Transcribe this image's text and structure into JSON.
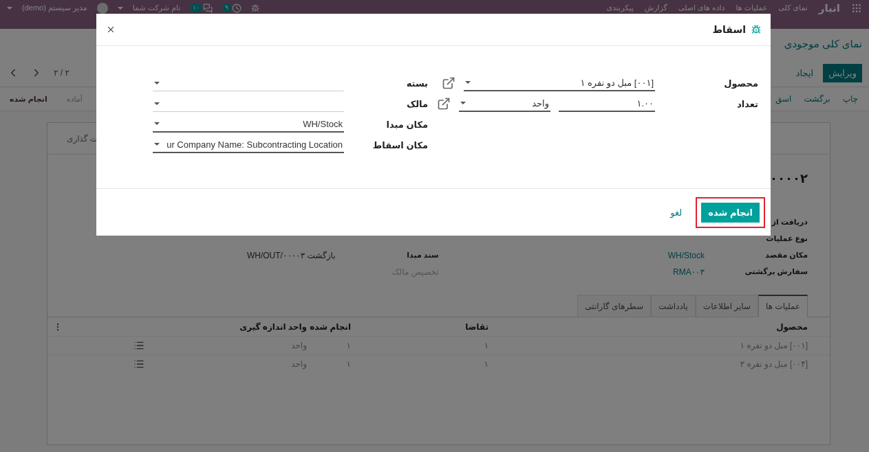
{
  "navbar": {
    "app_name": "انبار",
    "menu": [
      "نمای کلی",
      "عملیات ها",
      "داده های اصلی",
      "گزارش",
      "پیکربندی"
    ],
    "user": "مدیر سیستم (demo)",
    "company": "نام شرکت شما",
    "messages_count": "۱۰",
    "activities_count": "۹"
  },
  "breadcrumb": "نمای کلی موجودی",
  "buttons": [
    {
      "label": "ویرایش",
      "kind": "primary"
    },
    {
      "label": "ایجاد",
      "kind": "secondary"
    }
  ],
  "pager": "۲ / ۲",
  "actions": [
    "چاپ",
    "برگشت",
    "اسق"
  ],
  "stages": [
    {
      "label": "آماده",
      "selected": false
    },
    {
      "label": "انجام شده",
      "selected": true
    }
  ],
  "smart_button": "ت گذاری",
  "record_title": "۰۰۰۰۲",
  "fields_right": [
    {
      "label": "دریافت از"
    },
    {
      "label": "نوع عملیات"
    },
    {
      "label": "مکان مقصد",
      "value": "WH/Stock",
      "kind": "link"
    },
    {
      "label": "سفارش برگشتی",
      "value": "RMA۰۰۳",
      "kind": "link"
    }
  ],
  "fields_left": [
    {
      "kind": "hidden"
    },
    {
      "kind": "hidden"
    },
    {
      "label": "سند مبدا",
      "value": "بازگشت WH/OUT/۰۰۰۰۳",
      "kind": "text"
    },
    {
      "placeholder": "تخصیص مالک",
      "kind": "placeholder"
    }
  ],
  "notebook_tabs": [
    {
      "label": "عملیات ها",
      "selected": true
    },
    {
      "label": "سایر اطلاعات",
      "selected": false
    },
    {
      "label": "یادداشت",
      "selected": false
    },
    {
      "label": "سطرهای گارانتی",
      "selected": false
    }
  ],
  "table": {
    "columns": [
      "محصول",
      "تقاضا",
      "انجام شده",
      "واحد اندازه گیری"
    ],
    "rows": [
      {
        "product": "[۰۰۱] مبل دو نفره ۱",
        "demand": "۱",
        "done": "۱",
        "uom": "واحد"
      },
      {
        "product": "[۰۰۴] مبل دو نفره ۳",
        "demand": "۱",
        "done": "۱",
        "uom": "واحد"
      }
    ]
  },
  "dialog": {
    "title": "اسقاط",
    "right_fields": [
      {
        "label": "محصول",
        "value": "[۰۰۱] مبل دو نفره ۱",
        "kind": "many2one"
      },
      {
        "label": "تعداد",
        "value": "۱.۰۰",
        "unit": "واحد",
        "kind": "quantity"
      }
    ],
    "left_fields": [
      {
        "label": "بسته"
      },
      {
        "label": "مالک"
      },
      {
        "label": "مکان مبدا",
        "value": "WH/Stock"
      },
      {
        "label": "مکان اسقاط",
        "value": "ur Company Name: Subcontracting Location"
      }
    ],
    "confirm": "انجام شده",
    "cancel": "لغو",
    "confirm_highlighted": true
  }
}
